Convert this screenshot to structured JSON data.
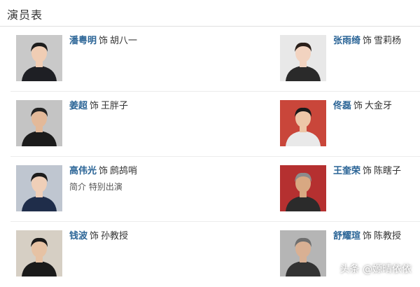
{
  "section": {
    "title": "演员表"
  },
  "cast": [
    {
      "actor": "潘粤明",
      "shi": "饰",
      "role": "胡八一",
      "note": "",
      "colors": {
        "bg": "#c9c9c9",
        "hair": "#1d1d1d",
        "skin": "#f0cdb4",
        "suit": "#1e1f24"
      }
    },
    {
      "actor": "张雨绮",
      "shi": "饰",
      "role": "雪莉杨",
      "note": "",
      "colors": {
        "bg": "#e8e8e8",
        "hair": "#2a1f1a",
        "skin": "#f2d3c0",
        "suit": "#2a2a2a"
      }
    },
    {
      "actor": "姜超",
      "shi": "饰",
      "role": "王胖子",
      "note": "",
      "colors": {
        "bg": "#c4c4c4",
        "hair": "#222222",
        "skin": "#e3b999",
        "suit": "#1b1b1b"
      }
    },
    {
      "actor": "佟磊",
      "shi": "饰",
      "role": "大金牙",
      "note": "",
      "colors": {
        "bg": "#c9463a",
        "hair": "#1a1a1a",
        "skin": "#edc7a8",
        "suit": "#e9e9e9"
      }
    },
    {
      "actor": "高伟光",
      "shi": "饰",
      "role": "鹧鸪哨",
      "note": "简介 特别出演",
      "colors": {
        "bg": "#bfc6d0",
        "hair": "#1c1c1c",
        "skin": "#efcfb8",
        "suit": "#1f2d4a"
      }
    },
    {
      "actor": "王奎荣",
      "shi": "饰",
      "role": "陈瞎子",
      "note": "",
      "colors": {
        "bg": "#b53030",
        "hair": "#8c8c8c",
        "skin": "#d8a882",
        "suit": "#2b2b2b"
      }
    },
    {
      "actor": "钱波",
      "shi": "饰",
      "role": "孙教授",
      "note": "",
      "colors": {
        "bg": "#d6cfc4",
        "hair": "#1a1a1a",
        "skin": "#e6c2a4",
        "suit": "#1a1a1a"
      }
    },
    {
      "actor": "舒耀瑄",
      "shi": "饰",
      "role": "陈教授",
      "note": "",
      "colors": {
        "bg": "#b5b5b5",
        "hair": "#6e6e6e",
        "skin": "#d9b093",
        "suit": "#333333"
      }
    }
  ],
  "watermark": "头条 @嫄晴依依"
}
